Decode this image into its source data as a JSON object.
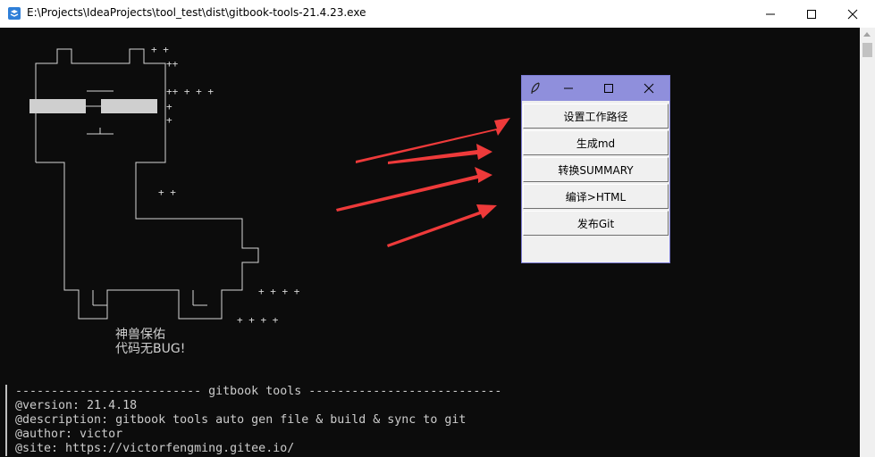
{
  "window": {
    "title": "E:\\Projects\\IdeaProjects\\tool_test\\dist\\gitbook-tools-21.4.23.exe"
  },
  "art": {
    "plus_marks": [
      "+ +",
      "++",
      "++ + + +",
      "+",
      "+",
      "+ +",
      "+ + + +",
      "+ + + +"
    ],
    "caption_line1": "神兽保佑",
    "caption_line2": "代码无BUG!"
  },
  "terminal": {
    "lines": [
      "-------------------------- gitbook tools ---------------------------",
      "@version: 21.4.18",
      "@description: gitbook tools auto gen file & build & sync to git",
      "@author: victor",
      "@site: https://victorfengming.gitee.io/"
    ]
  },
  "tk_window": {
    "buttons": [
      "设置工作路径",
      "生成md",
      "转换SUMMARY",
      "编译>HTML",
      "发布Git"
    ]
  },
  "colors": {
    "console_bg": "#0c0c0c",
    "tk_titlebar": "#8f8fdc",
    "arrow": "#ee3a3a"
  },
  "icons": [
    "app-icon",
    "minimize-icon",
    "maximize-icon",
    "close-icon",
    "feather-icon",
    "arrow-annotation"
  ]
}
